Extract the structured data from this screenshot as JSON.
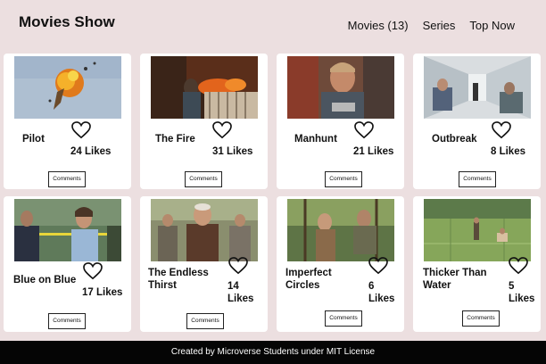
{
  "header": {
    "logo": "Movies Show",
    "nav": [
      {
        "label": "Movies (13)"
      },
      {
        "label": "Series"
      },
      {
        "label": "Top Now"
      }
    ]
  },
  "cards": [
    {
      "title": "Pilot",
      "likes": "24 Likes",
      "comments_label": "Comments"
    },
    {
      "title": "The Fire",
      "likes": "31 Likes",
      "comments_label": "Comments"
    },
    {
      "title": "Manhunt",
      "likes": "21 Likes",
      "comments_label": "Comments"
    },
    {
      "title": "Outbreak",
      "likes": "8 Likes",
      "comments_label": "Comments"
    },
    {
      "title": "Blue on Blue",
      "likes": "17 Likes",
      "comments_label": "Comments"
    },
    {
      "title_line1": "The Endless",
      "title_line2": "Thirst",
      "likes_n": "14",
      "likes_word": "Likes",
      "comments_label": "Comments"
    },
    {
      "title_line1": "Imperfect",
      "title_line2": "Circles",
      "likes_n": "6",
      "likes_word": "Likes",
      "comments_label": "Comments"
    },
    {
      "title_line1": "Thicker Than",
      "title_line2": "Water",
      "likes_n": "5",
      "likes_word": "Likes",
      "comments_label": "Comments"
    }
  ],
  "footer": {
    "text": "Created by Microverse Students under MIT License"
  }
}
